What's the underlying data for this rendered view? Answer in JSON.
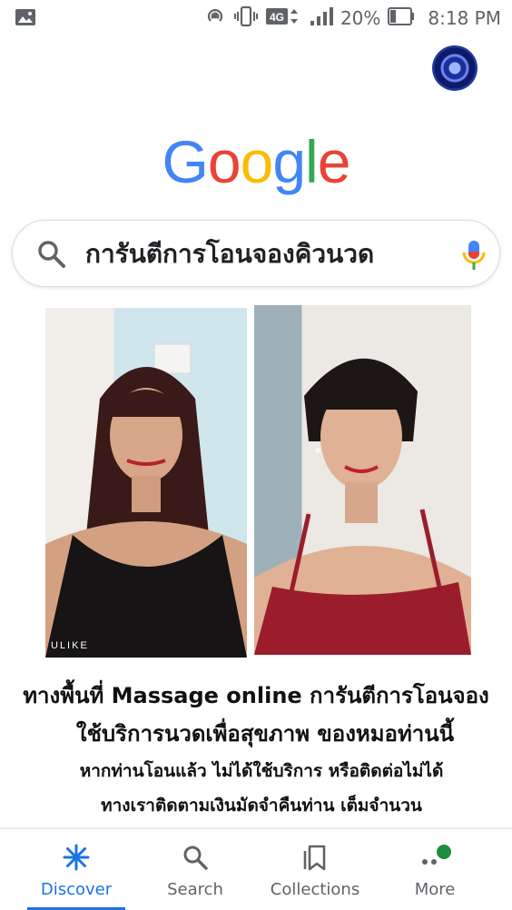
{
  "status_bar": {
    "network_label": "4G",
    "battery_percent": "20%",
    "time": "8:18 PM",
    "icons": [
      "gallery-icon",
      "hotspot-icon",
      "vibrate-icon",
      "network-4g-icon",
      "signal-icon",
      "battery-icon"
    ]
  },
  "google_logo": {
    "letters": [
      "G",
      "o",
      "o",
      "g",
      "l",
      "e"
    ],
    "colors": [
      "#4285f4",
      "#ea4335",
      "#fbbc05",
      "#4285f4",
      "#34a853",
      "#ea4335"
    ]
  },
  "search": {
    "query": "การันตีการโอนจองคิวนวด"
  },
  "caption": {
    "line1": "ทางพื้นที่ Massage online การันตีการโอนจอง",
    "line2": "ใช้บริการนวดเพื่อสุขภาพ ของหมอท่านนี้",
    "line3": "หากท่านโอนแล้ว ไม่ได้ใช้บริการ หรือติดต่อไม่ได้",
    "line4": "ทางเราติดตามเงินมัดจำคืนท่าน เต็มจำนวน"
  },
  "photos": {
    "left_watermark": "ULIKE"
  },
  "bottom_nav": {
    "discover": "Discover",
    "search": "Search",
    "collections": "Collections",
    "more": "More"
  },
  "colors": {
    "accent": "#1a73e8",
    "notification_dot": "#1e8e3e"
  }
}
